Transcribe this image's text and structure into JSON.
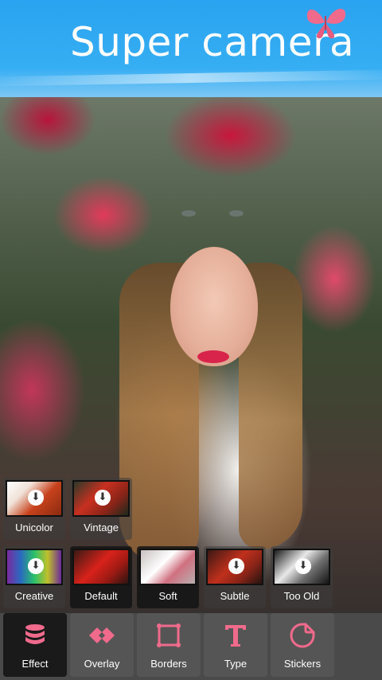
{
  "header": {
    "title": "Super camera"
  },
  "filters": [
    {
      "id": "unicolor",
      "label": "Unicolor",
      "downloadable": true
    },
    {
      "id": "vintage",
      "label": "Vintage",
      "downloadable": true
    },
    {
      "id": "creative",
      "label": "Creative",
      "downloadable": true
    },
    {
      "id": "default",
      "label": "Default",
      "downloadable": false
    },
    {
      "id": "soft",
      "label": "Soft",
      "downloadable": false
    },
    {
      "id": "subtle",
      "label": "Subtle",
      "downloadable": true
    },
    {
      "id": "too_old",
      "label": "Too Old",
      "downloadable": true
    }
  ],
  "tools": [
    {
      "id": "effect",
      "label": "Effect",
      "icon": "database-stack-icon",
      "selected": true
    },
    {
      "id": "overlay",
      "label": "Overlay",
      "icon": "overlay-diamond-icon",
      "selected": false
    },
    {
      "id": "borders",
      "label": "Borders",
      "icon": "frame-icon",
      "selected": false
    },
    {
      "id": "type",
      "label": "Type",
      "icon": "text-t-icon",
      "selected": false
    },
    {
      "id": "stickers",
      "label": "Stickers",
      "icon": "sticker-icon",
      "selected": false
    }
  ],
  "colors": {
    "accent": "#f06a8c",
    "header_blue": "#2aa3f0"
  }
}
